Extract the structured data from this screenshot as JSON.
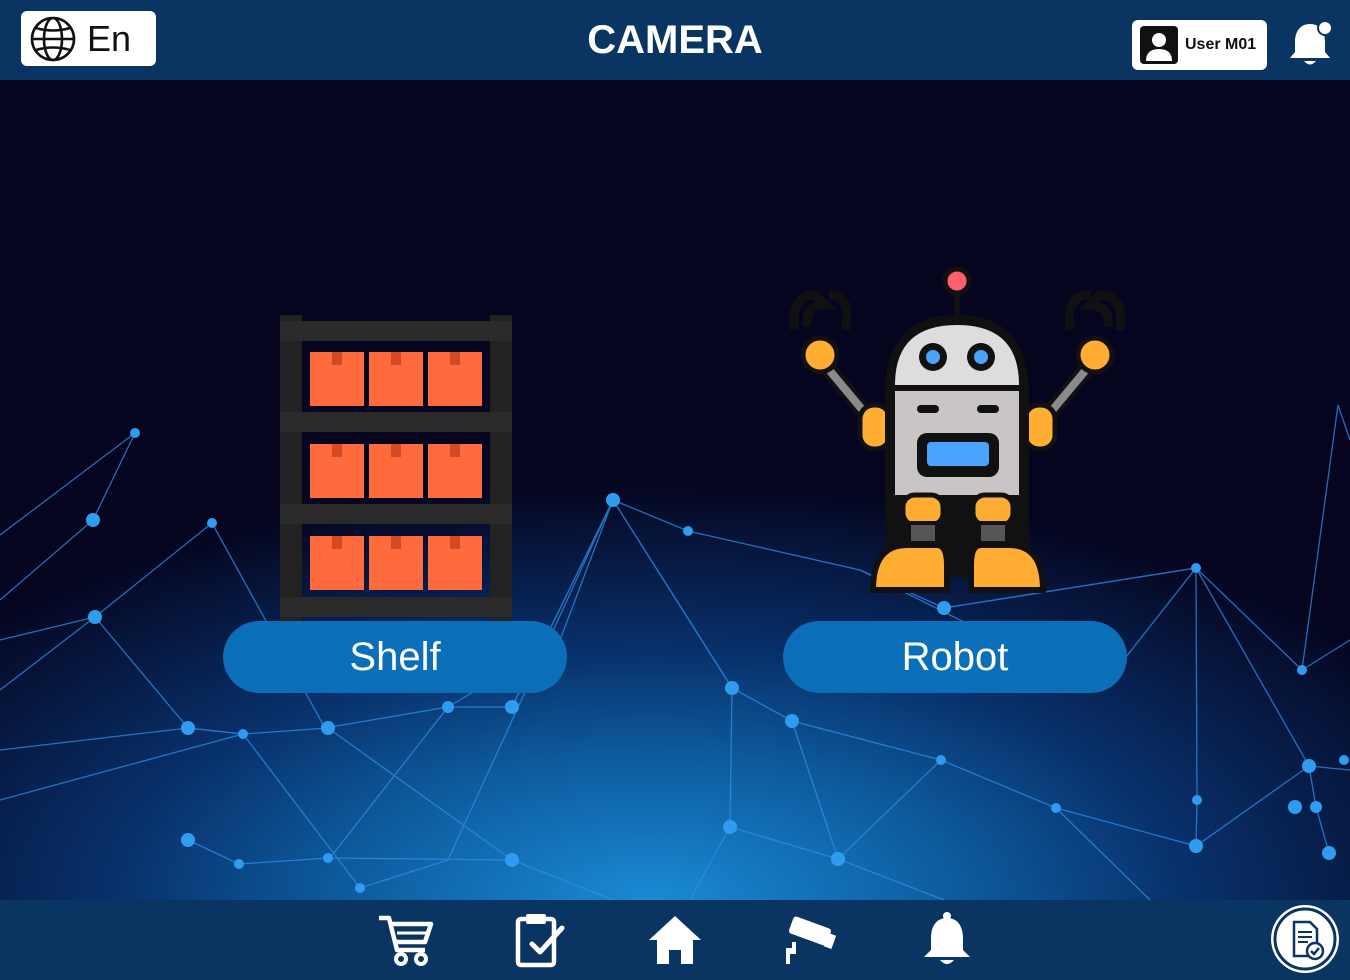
{
  "header": {
    "title": "CAMERA",
    "language_label": "En",
    "user_label": "User M01"
  },
  "main": {
    "options": [
      {
        "label": "Shelf"
      },
      {
        "label": "Robot"
      }
    ]
  },
  "bottom_nav": {
    "items": [
      {
        "icon": "cart-icon"
      },
      {
        "icon": "clipboard-check-icon"
      },
      {
        "icon": "home-icon"
      },
      {
        "icon": "security-camera-icon"
      },
      {
        "icon": "bell-icon"
      }
    ],
    "report_icon": "document-check-icon"
  },
  "colors": {
    "bar": "#0a3461",
    "accent": "#0b6eb8",
    "background": "#05051f"
  }
}
